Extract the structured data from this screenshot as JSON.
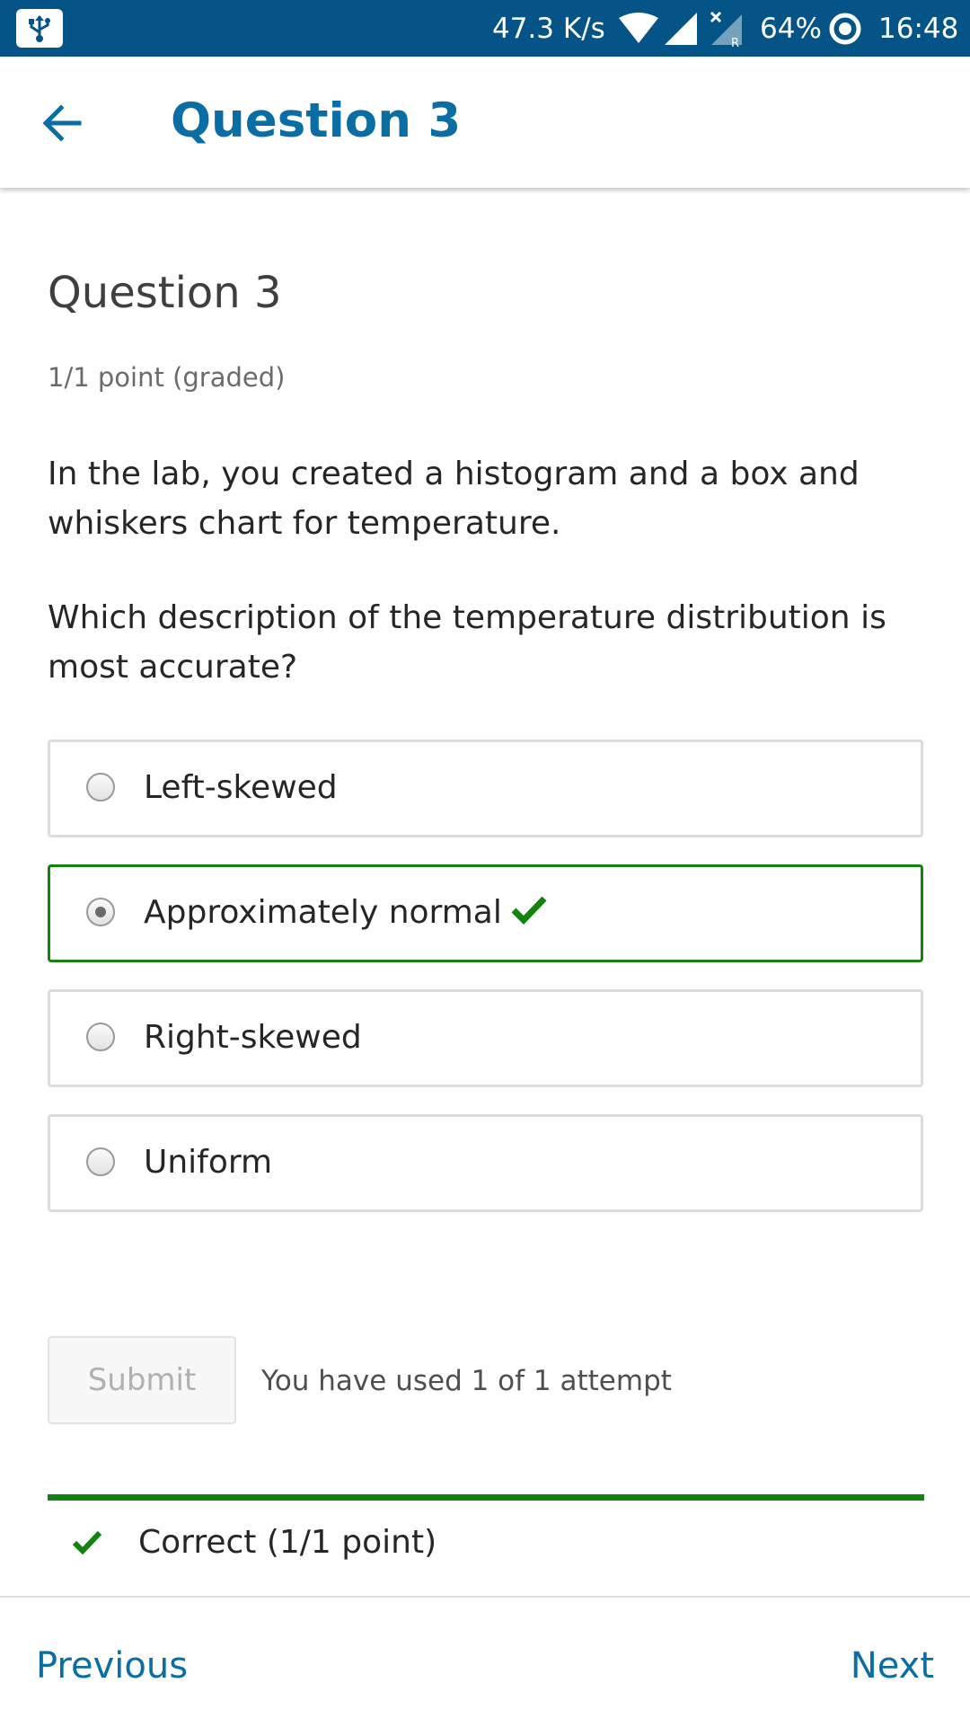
{
  "status_bar": {
    "net_speed": "47.3 K/s",
    "battery": "64%",
    "time": "16:48",
    "icons": [
      "usb-icon",
      "wifi-icon",
      "cell-signal-icon",
      "cell-signal-roaming-icon",
      "battery-saver-icon"
    ]
  },
  "app_bar": {
    "title": "Question 3",
    "back_icon": "arrow-left-icon"
  },
  "problem": {
    "heading": "Question 3",
    "points": "1/1 point (graded)",
    "text_1": "In the lab, you created a histogram and a box and whiskers chart for temperature.",
    "text_2": "Which description of the temperature distribution is most accurate?",
    "options": [
      {
        "label": "Left-skewed",
        "selected": false,
        "correct": false
      },
      {
        "label": "Approximately normal",
        "selected": true,
        "correct": true
      },
      {
        "label": "Right-skewed",
        "selected": false,
        "correct": false
      },
      {
        "label": "Uniform",
        "selected": false,
        "correct": false
      }
    ]
  },
  "submit": {
    "label": "Submit",
    "attempts": "You have used 1 of 1 attempt"
  },
  "feedback": {
    "text": "Correct (1/1 point)",
    "color": "#11830e"
  },
  "navigation": {
    "previous": "Previous",
    "next": "Next"
  },
  "colors": {
    "status_bar": "#045488",
    "accent": "#0a6ea5",
    "correct": "#11830e"
  }
}
